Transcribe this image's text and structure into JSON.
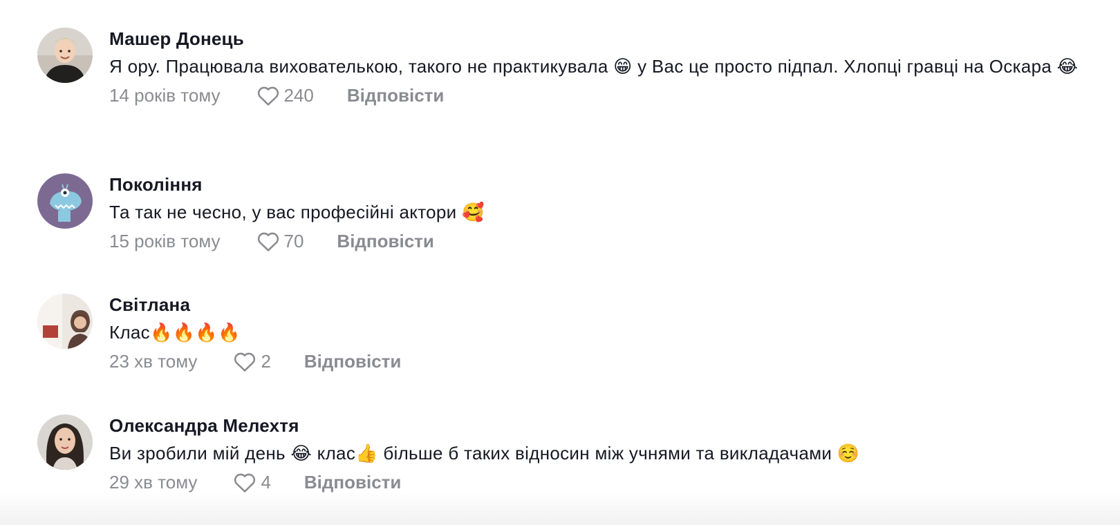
{
  "comments": [
    {
      "author": "Машер Донець",
      "text": "Я ору. Працювала вихователькою, такого не практикувала 😁 у Вас це просто підпал. Хлопці гравці на Оскара 😂",
      "time": "14 років тому",
      "likes": "240",
      "reply_label": "Відповісти"
    },
    {
      "author": "Покоління",
      "text": "Та так не чесно, у вас професійні актори 🥰",
      "time": "15 років тому",
      "likes": "70",
      "reply_label": "Відповісти"
    },
    {
      "author": "Світлана",
      "text": "Клас🔥🔥🔥🔥",
      "time": "23 хв тому",
      "likes": "2",
      "reply_label": "Відповісти"
    },
    {
      "author": "Олександра Мелехтя",
      "text": "Ви зробили мій день 😂 клас👍 більше б таких відносин між учнями та викладачами ☺️",
      "time": "29 хв тому",
      "likes": "4",
      "reply_label": "Відповісти"
    }
  ],
  "icons": {
    "like": "heart-outline-icon"
  },
  "colors": {
    "text": "#161823",
    "secondary": "#8a8b91"
  }
}
